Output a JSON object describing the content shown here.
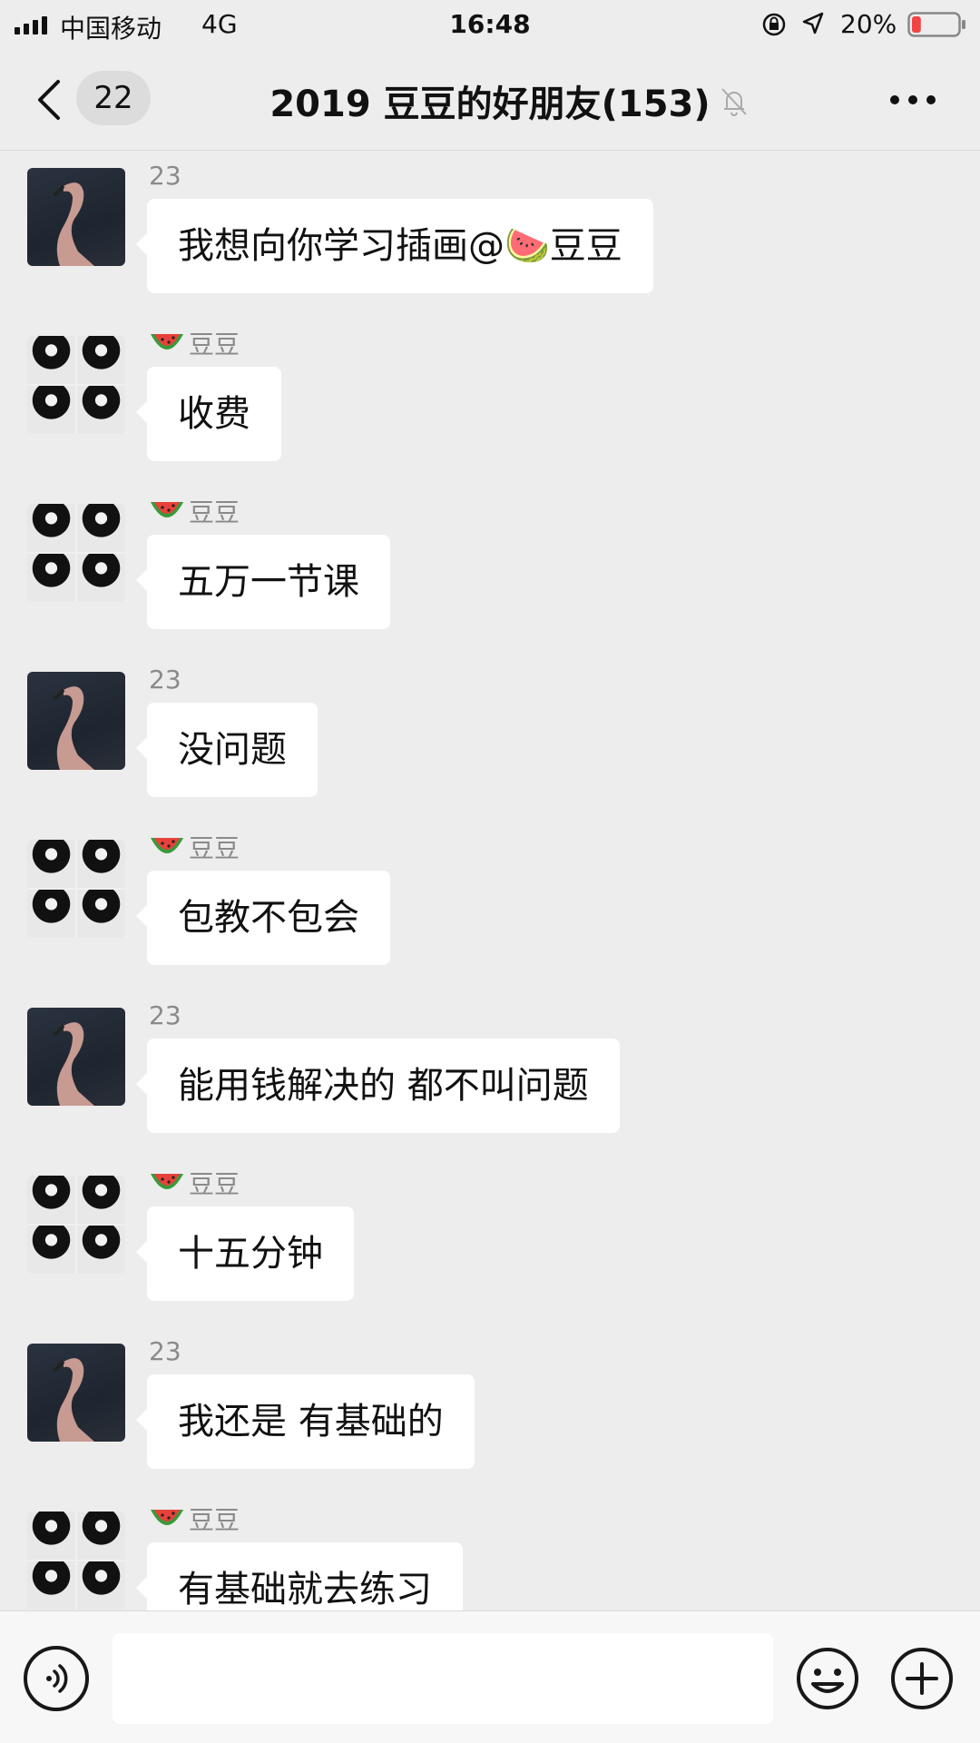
{
  "status_bar": {
    "carrier": "中国移动",
    "network": "4G",
    "time": "16:48",
    "battery": "20%",
    "battery_level": 0.2,
    "battery_color": "#f04545"
  },
  "nav": {
    "back_icon": "chevron-left-icon",
    "unread_count": "22",
    "title": "2019 豆豆的好朋友(153)",
    "mute_icon": "bell-off-icon",
    "more_icon": "more-icon"
  },
  "messages": [
    {
      "sender": "23",
      "sender_emoji": false,
      "avatar": "flamingo",
      "text": "我想向你学习插画@🍉豆豆"
    },
    {
      "sender": "豆豆",
      "sender_emoji": true,
      "avatar": "grid",
      "text": "收费"
    },
    {
      "sender": "豆豆",
      "sender_emoji": true,
      "avatar": "grid",
      "text": "五万一节课"
    },
    {
      "sender": "23",
      "sender_emoji": false,
      "avatar": "flamingo",
      "text": "没问题"
    },
    {
      "sender": "豆豆",
      "sender_emoji": true,
      "avatar": "grid",
      "text": "包教不包会"
    },
    {
      "sender": "23",
      "sender_emoji": false,
      "avatar": "flamingo",
      "text": "能用钱解决的 都不叫问题"
    },
    {
      "sender": "豆豆",
      "sender_emoji": true,
      "avatar": "grid",
      "text": "十五分钟"
    },
    {
      "sender": "23",
      "sender_emoji": false,
      "avatar": "flamingo",
      "text": "我还是 有基础的"
    },
    {
      "sender": "豆豆",
      "sender_emoji": true,
      "avatar": "grid",
      "text": "有基础就去练习"
    }
  ],
  "input_bar": {
    "voice_icon": "voice-icon",
    "input_value": "",
    "emoji_icon": "emoji-icon",
    "plus_icon": "plus-icon"
  },
  "colors": {
    "background": "#ededed",
    "bubble": "#ffffff",
    "melon_red": "#e8413c",
    "melon_green": "#3a9a3a"
  }
}
